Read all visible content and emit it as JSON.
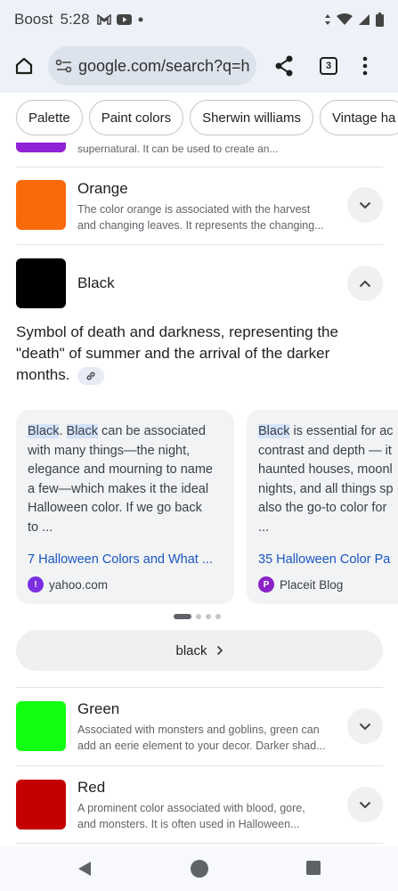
{
  "status_bar": {
    "carrier": "Boost",
    "time": "5:28",
    "icons": [
      "gmail-icon",
      "youtube-icon",
      "dot-icon",
      "data-arrows-icon",
      "wifi-icon",
      "signal-icon",
      "battery-icon"
    ]
  },
  "browser": {
    "url": "google.com/search?q=h",
    "tab_count": "3"
  },
  "chips": [
    "Palette",
    "Paint colors",
    "Sherwin williams",
    "Vintage ha"
  ],
  "partial_item": {
    "desc": "supernatural. It can be used to create an...",
    "color": "#8f21d6"
  },
  "colors": [
    {
      "name": "Orange",
      "swatch": "#f96a0b",
      "desc_line1": "The color orange is associated with the harvest",
      "desc_line2": "and changing leaves. It represents the changing..."
    },
    {
      "name": "Black",
      "swatch": "#000000",
      "expanded": true
    },
    {
      "name": "Green",
      "swatch": "#11ff11",
      "desc_line1": "Associated with monsters and goblins, green can",
      "desc_line2": "add an eerie element to your decor. Darker shad..."
    },
    {
      "name": "Red",
      "swatch": "#c40000",
      "desc_line1": "A prominent color associated with blood, gore,",
      "desc_line2": "and monsters. It is often used in Halloween..."
    }
  ],
  "black_detail": {
    "summary": "Symbol of death and darkness, representing the \"death\" of summer and the arrival of the darker months.",
    "summary_line1": "Symbol of death and darkness, representing the",
    "summary_line2": "\"death\" of summer and the arrival of the darker",
    "summary_line3": "months.",
    "more_label": "black"
  },
  "cards": [
    {
      "hl1": "Black",
      "sep": ". ",
      "hl2": "Black",
      "line1_rest": " can be associated",
      "line2": "with many things—the night,",
      "line3": "elegance and mourning to name",
      "line4": "a few—which makes it the ideal",
      "line5": "Halloween color. If we go back",
      "line6": "to ...",
      "link": "7 Halloween Colors and What ...",
      "source": "yahoo.com",
      "source_icon_color": "#7b2fe0"
    },
    {
      "hl1": "Black",
      "line1_rest": " is essential for ac",
      "line2": "contrast and depth — it",
      "line3": "haunted houses, moonl",
      "line4": "nights, and all things sp",
      "line5": "also the go-to color for",
      "line6": "...",
      "link": "35 Halloween Color Pa",
      "source": "Placeit Blog",
      "source_icon_color": "#8a22c9"
    }
  ],
  "pagination": {
    "active": 1,
    "total": 4
  },
  "nav": [
    "back-icon",
    "home-icon",
    "recents-icon"
  ]
}
